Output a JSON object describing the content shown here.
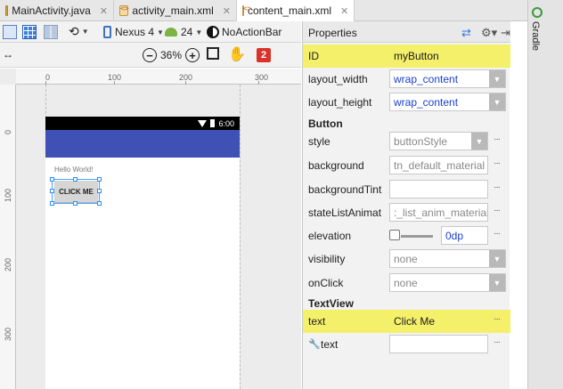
{
  "tabs": [
    {
      "label": "MainActivity.java",
      "icon": "java-file-icon",
      "active": false
    },
    {
      "label": "activity_main.xml",
      "icon": "xml-file-icon",
      "active": false
    },
    {
      "label": "content_main.xml",
      "icon": "xml-file-icon",
      "active": true
    }
  ],
  "toolbar": {
    "device": "Nexus 4",
    "api_level": "24",
    "theme": "NoActionBar",
    "zoom": "36%",
    "error_count": "2"
  },
  "ruler": {
    "top": [
      "0",
      "100",
      "200",
      "300"
    ],
    "left": [
      "0",
      "100",
      "200",
      "300"
    ]
  },
  "preview": {
    "status_time": "6:00",
    "hello_text": "Hello World!",
    "button_text": "CLICK ME",
    "colors": {
      "appbar": "#3f51b5",
      "statusbar": "#000000"
    }
  },
  "properties": {
    "title": "Properties",
    "id": {
      "label": "ID",
      "value": "myButton"
    },
    "layout_width": {
      "label": "layout_width",
      "value": "wrap_content"
    },
    "layout_height": {
      "label": "layout_height",
      "value": "wrap_content"
    },
    "button_section": "Button",
    "style": {
      "label": "style",
      "value": "buttonStyle"
    },
    "background": {
      "label": "background",
      "value": "tn_default_material"
    },
    "backgroundTint": {
      "label": "backgroundTint",
      "value": ""
    },
    "stateListAnimator": {
      "label": "stateListAnimat",
      "value": ":_list_anim_material"
    },
    "elevation": {
      "label": "elevation",
      "value": "0dp"
    },
    "visibility": {
      "label": "visibility",
      "value": "none"
    },
    "onClick": {
      "label": "onClick",
      "value": "none"
    },
    "textview_section": "TextView",
    "text": {
      "label": "text",
      "value": "Click Me"
    },
    "tools_text": {
      "label": "text",
      "value": ""
    },
    "highlight_color": "#f5f06a"
  },
  "side": {
    "gradle_label": "Gradle"
  }
}
